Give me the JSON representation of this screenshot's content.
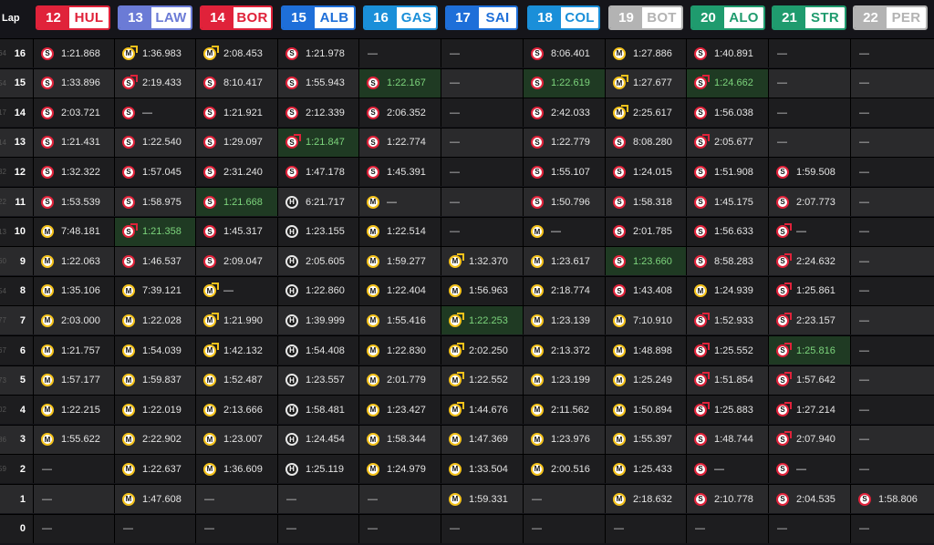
{
  "header": {
    "lap_label": "Lap"
  },
  "drivers": [
    {
      "num": "12",
      "code": "HUL",
      "color": "#e0223a"
    },
    {
      "num": "13",
      "code": "LAW",
      "color": "#6b7bd6"
    },
    {
      "num": "14",
      "code": "BOR",
      "color": "#e0223a"
    },
    {
      "num": "15",
      "code": "ALB",
      "color": "#1e6fd9"
    },
    {
      "num": "16",
      "code": "GAS",
      "color": "#1a8fd9"
    },
    {
      "num": "17",
      "code": "SAI",
      "color": "#1e6fd9"
    },
    {
      "num": "18",
      "code": "COL",
      "color": "#1a8fd9"
    },
    {
      "num": "19",
      "code": "BOT",
      "color": "#b3b3b3"
    },
    {
      "num": "20",
      "code": "ALO",
      "color": "#1f9b6e"
    },
    {
      "num": "21",
      "code": "STR",
      "color": "#1f9b6e"
    },
    {
      "num": "22",
      "code": "PER",
      "color": "#b3b3b3"
    }
  ],
  "rows": [
    {
      "lap": "16",
      "ghost": "64",
      "cells": [
        {
          "t": "S",
          "v": "1:21.868"
        },
        {
          "t": "M",
          "p": 1,
          "v": "1:36.983"
        },
        {
          "t": "M",
          "p": 1,
          "v": "2:08.453"
        },
        {
          "t": "S",
          "v": "1:21.978"
        },
        {
          "v": "—"
        },
        {
          "v": "—"
        },
        {
          "t": "S",
          "v": "8:06.401"
        },
        {
          "t": "M",
          "v": "1:27.886"
        },
        {
          "t": "S",
          "v": "1:40.891"
        },
        {
          "v": "—"
        },
        {
          "v": "—"
        }
      ]
    },
    {
      "lap": "15",
      "ghost": "54",
      "cells": [
        {
          "t": "S",
          "v": "1:33.896"
        },
        {
          "t": "S",
          "p": 1,
          "v": "2:19.433"
        },
        {
          "t": "S",
          "v": "8:10.417"
        },
        {
          "t": "S",
          "v": "1:55.943"
        },
        {
          "t": "S",
          "b": 1,
          "v": "1:22.167"
        },
        {
          "v": "—"
        },
        {
          "t": "S",
          "b": 1,
          "v": "1:22.619"
        },
        {
          "t": "M",
          "p": 1,
          "v": "1:27.677"
        },
        {
          "t": "S",
          "p": 1,
          "b": 1,
          "v": "1:24.662"
        },
        {
          "v": "—"
        },
        {
          "v": "—"
        }
      ]
    },
    {
      "lap": "14",
      "ghost": "17",
      "cells": [
        {
          "t": "S",
          "v": "2:03.721"
        },
        {
          "t": "S",
          "v": "—"
        },
        {
          "t": "S",
          "v": "1:21.921"
        },
        {
          "t": "S",
          "v": "2:12.339"
        },
        {
          "t": "S",
          "v": "2:06.352"
        },
        {
          "v": "—"
        },
        {
          "t": "S",
          "v": "2:42.033"
        },
        {
          "t": "M",
          "p": 1,
          "v": "2:25.617"
        },
        {
          "t": "S",
          "v": "1:56.038"
        },
        {
          "v": "—"
        },
        {
          "v": "—"
        }
      ]
    },
    {
      "lap": "13",
      "ghost": "14",
      "cells": [
        {
          "t": "S",
          "v": "1:21.431"
        },
        {
          "t": "S",
          "v": "1:22.540"
        },
        {
          "t": "S",
          "v": "1:29.097"
        },
        {
          "t": "S",
          "p": 1,
          "b": 1,
          "v": "1:21.847"
        },
        {
          "t": "S",
          "v": "1:22.774"
        },
        {
          "v": "—"
        },
        {
          "t": "S",
          "v": "1:22.779"
        },
        {
          "t": "S",
          "v": "8:08.280"
        },
        {
          "t": "S",
          "p": 1,
          "v": "2:05.677"
        },
        {
          "v": "—"
        },
        {
          "v": "—"
        }
      ]
    },
    {
      "lap": "12",
      "ghost": "32",
      "cells": [
        {
          "t": "S",
          "v": "1:32.322"
        },
        {
          "t": "S",
          "v": "1:57.045"
        },
        {
          "t": "S",
          "v": "2:31.240"
        },
        {
          "t": "S",
          "v": "1:47.178"
        },
        {
          "t": "S",
          "v": "1:45.391"
        },
        {
          "v": "—"
        },
        {
          "t": "S",
          "v": "1:55.107"
        },
        {
          "t": "S",
          "v": "1:24.015"
        },
        {
          "t": "S",
          "v": "1:51.908"
        },
        {
          "t": "S",
          "v": "1:59.508"
        },
        {
          "v": "—"
        }
      ]
    },
    {
      "lap": "11",
      "ghost": "22",
      "cells": [
        {
          "t": "S",
          "v": "1:53.539"
        },
        {
          "t": "S",
          "v": "1:58.975"
        },
        {
          "t": "S",
          "b": 1,
          "v": "1:21.668"
        },
        {
          "t": "H",
          "v": "6:21.717"
        },
        {
          "t": "M",
          "v": "—"
        },
        {
          "v": "—"
        },
        {
          "t": "S",
          "v": "1:50.796"
        },
        {
          "t": "S",
          "v": "1:58.318"
        },
        {
          "t": "S",
          "v": "1:45.175"
        },
        {
          "t": "S",
          "v": "2:07.773"
        },
        {
          "v": "—"
        }
      ]
    },
    {
      "lap": "10",
      "ghost": "13",
      "cells": [
        {
          "t": "M",
          "v": "7:48.181"
        },
        {
          "t": "S",
          "p": 1,
          "b": 1,
          "v": "1:21.358"
        },
        {
          "t": "S",
          "v": "1:45.317"
        },
        {
          "t": "H",
          "v": "1:23.155"
        },
        {
          "t": "M",
          "v": "1:22.514"
        },
        {
          "v": "—"
        },
        {
          "t": "M",
          "v": "—"
        },
        {
          "t": "S",
          "v": "2:01.785"
        },
        {
          "t": "S",
          "v": "1:56.633"
        },
        {
          "t": "S",
          "p": 1,
          "v": "—"
        },
        {
          "v": "—"
        }
      ]
    },
    {
      "lap": "9",
      "ghost": "60",
      "cells": [
        {
          "t": "M",
          "v": "1:22.063"
        },
        {
          "t": "S",
          "v": "1:46.537"
        },
        {
          "t": "S",
          "v": "2:09.047"
        },
        {
          "t": "H",
          "v": "2:05.605"
        },
        {
          "t": "M",
          "v": "1:59.277"
        },
        {
          "t": "M",
          "p": 1,
          "v": "1:32.370"
        },
        {
          "t": "M",
          "v": "1:23.617"
        },
        {
          "t": "S",
          "b": 1,
          "v": "1:23.660"
        },
        {
          "t": "S",
          "v": "8:58.283"
        },
        {
          "t": "S",
          "p": 1,
          "v": "2:24.632"
        },
        {
          "v": "—"
        }
      ]
    },
    {
      "lap": "8",
      "ghost": "54",
      "cells": [
        {
          "t": "M",
          "v": "1:35.106"
        },
        {
          "t": "M",
          "v": "7:39.121"
        },
        {
          "t": "M",
          "p": 1,
          "v": "—"
        },
        {
          "t": "H",
          "v": "1:22.860"
        },
        {
          "t": "M",
          "v": "1:22.404"
        },
        {
          "t": "M",
          "v": "1:56.963"
        },
        {
          "t": "M",
          "v": "2:18.774"
        },
        {
          "t": "S",
          "v": "1:43.408"
        },
        {
          "t": "M",
          "v": "1:24.939"
        },
        {
          "t": "S",
          "p": 1,
          "v": "1:25.861"
        },
        {
          "v": "—"
        }
      ]
    },
    {
      "lap": "7",
      "ghost": "77",
      "cells": [
        {
          "t": "M",
          "v": "2:03.000"
        },
        {
          "t": "M",
          "v": "1:22.028"
        },
        {
          "t": "M",
          "p": 1,
          "v": "1:21.990"
        },
        {
          "t": "H",
          "v": "1:39.999"
        },
        {
          "t": "M",
          "v": "1:55.416"
        },
        {
          "t": "M",
          "p": 1,
          "b": 1,
          "v": "1:22.253"
        },
        {
          "t": "M",
          "v": "1:23.139"
        },
        {
          "t": "M",
          "v": "7:10.910"
        },
        {
          "t": "S",
          "p": 1,
          "v": "1:52.933"
        },
        {
          "t": "S",
          "p": 1,
          "v": "2:23.157"
        },
        {
          "v": "—"
        }
      ]
    },
    {
      "lap": "6",
      "ghost": "67",
      "cells": [
        {
          "t": "M",
          "v": "1:21.757"
        },
        {
          "t": "M",
          "v": "1:54.039"
        },
        {
          "t": "M",
          "p": 1,
          "v": "1:42.132"
        },
        {
          "t": "H",
          "v": "1:54.408"
        },
        {
          "t": "M",
          "v": "1:22.830"
        },
        {
          "t": "M",
          "p": 1,
          "v": "2:02.250"
        },
        {
          "t": "M",
          "v": "2:13.372"
        },
        {
          "t": "M",
          "v": "1:48.898"
        },
        {
          "t": "S",
          "p": 1,
          "v": "1:25.552"
        },
        {
          "t": "S",
          "p": 1,
          "b": 1,
          "v": "1:25.816"
        },
        {
          "v": "—"
        }
      ]
    },
    {
      "lap": "5",
      "ghost": "73",
      "cells": [
        {
          "t": "M",
          "v": "1:57.177"
        },
        {
          "t": "M",
          "v": "1:59.837"
        },
        {
          "t": "M",
          "v": "1:52.487"
        },
        {
          "t": "H",
          "v": "1:23.557"
        },
        {
          "t": "M",
          "v": "2:01.779"
        },
        {
          "t": "M",
          "p": 1,
          "v": "1:22.552"
        },
        {
          "t": "M",
          "v": "1:23.199"
        },
        {
          "t": "M",
          "v": "1:25.249"
        },
        {
          "t": "S",
          "p": 1,
          "v": "1:51.854"
        },
        {
          "t": "S",
          "p": 1,
          "v": "1:57.642"
        },
        {
          "v": "—"
        }
      ]
    },
    {
      "lap": "4",
      "ghost": "02",
      "cells": [
        {
          "t": "M",
          "v": "1:22.215"
        },
        {
          "t": "M",
          "v": "1:22.019"
        },
        {
          "t": "M",
          "v": "2:13.666"
        },
        {
          "t": "H",
          "v": "1:58.481"
        },
        {
          "t": "M",
          "v": "1:23.427"
        },
        {
          "t": "M",
          "p": 1,
          "v": "1:44.676"
        },
        {
          "t": "M",
          "v": "2:11.562"
        },
        {
          "t": "M",
          "v": "1:50.894"
        },
        {
          "t": "S",
          "p": 1,
          "v": "1:25.883"
        },
        {
          "t": "S",
          "p": 1,
          "v": "1:27.214"
        },
        {
          "v": "—"
        }
      ]
    },
    {
      "lap": "3",
      "ghost": "86",
      "cells": [
        {
          "t": "M",
          "v": "1:55.622"
        },
        {
          "t": "M",
          "v": "2:22.902"
        },
        {
          "t": "M",
          "v": "1:23.007"
        },
        {
          "t": "H",
          "v": "1:24.454"
        },
        {
          "t": "M",
          "v": "1:58.344"
        },
        {
          "t": "M",
          "v": "1:47.369"
        },
        {
          "t": "M",
          "v": "1:23.976"
        },
        {
          "t": "M",
          "v": "1:55.397"
        },
        {
          "t": "S",
          "v": "1:48.744"
        },
        {
          "t": "S",
          "p": 1,
          "v": "2:07.940"
        },
        {
          "v": "—"
        }
      ]
    },
    {
      "lap": "2",
      "ghost": "59",
      "cells": [
        {
          "v": "—"
        },
        {
          "t": "M",
          "v": "1:22.637"
        },
        {
          "t": "M",
          "v": "1:36.609"
        },
        {
          "t": "H",
          "v": "1:25.119"
        },
        {
          "t": "M",
          "v": "1:24.979"
        },
        {
          "t": "M",
          "v": "1:33.504"
        },
        {
          "t": "M",
          "v": "2:00.516"
        },
        {
          "t": "M",
          "v": "1:25.433"
        },
        {
          "t": "S",
          "v": "—"
        },
        {
          "t": "S",
          "v": "—"
        },
        {
          "v": "—"
        }
      ]
    },
    {
      "lap": "1",
      "ghost": "",
      "cells": [
        {
          "v": "—"
        },
        {
          "t": "M",
          "v": "1:47.608"
        },
        {
          "v": "—"
        },
        {
          "v": "—"
        },
        {
          "v": "—"
        },
        {
          "t": "M",
          "v": "1:59.331"
        },
        {
          "v": "—"
        },
        {
          "t": "M",
          "v": "2:18.632"
        },
        {
          "t": "S",
          "v": "2:10.778"
        },
        {
          "t": "S",
          "v": "2:04.535"
        },
        {
          "t": "S",
          "v": "1:58.806"
        }
      ]
    },
    {
      "lap": "0",
      "ghost": "",
      "cells": [
        {
          "v": "—"
        },
        {
          "v": "—"
        },
        {
          "v": "—"
        },
        {
          "v": "—"
        },
        {
          "v": "—"
        },
        {
          "v": "—"
        },
        {
          "v": "—"
        },
        {
          "v": "—"
        },
        {
          "v": "—"
        },
        {
          "v": "—"
        },
        {
          "v": "—"
        }
      ]
    }
  ]
}
